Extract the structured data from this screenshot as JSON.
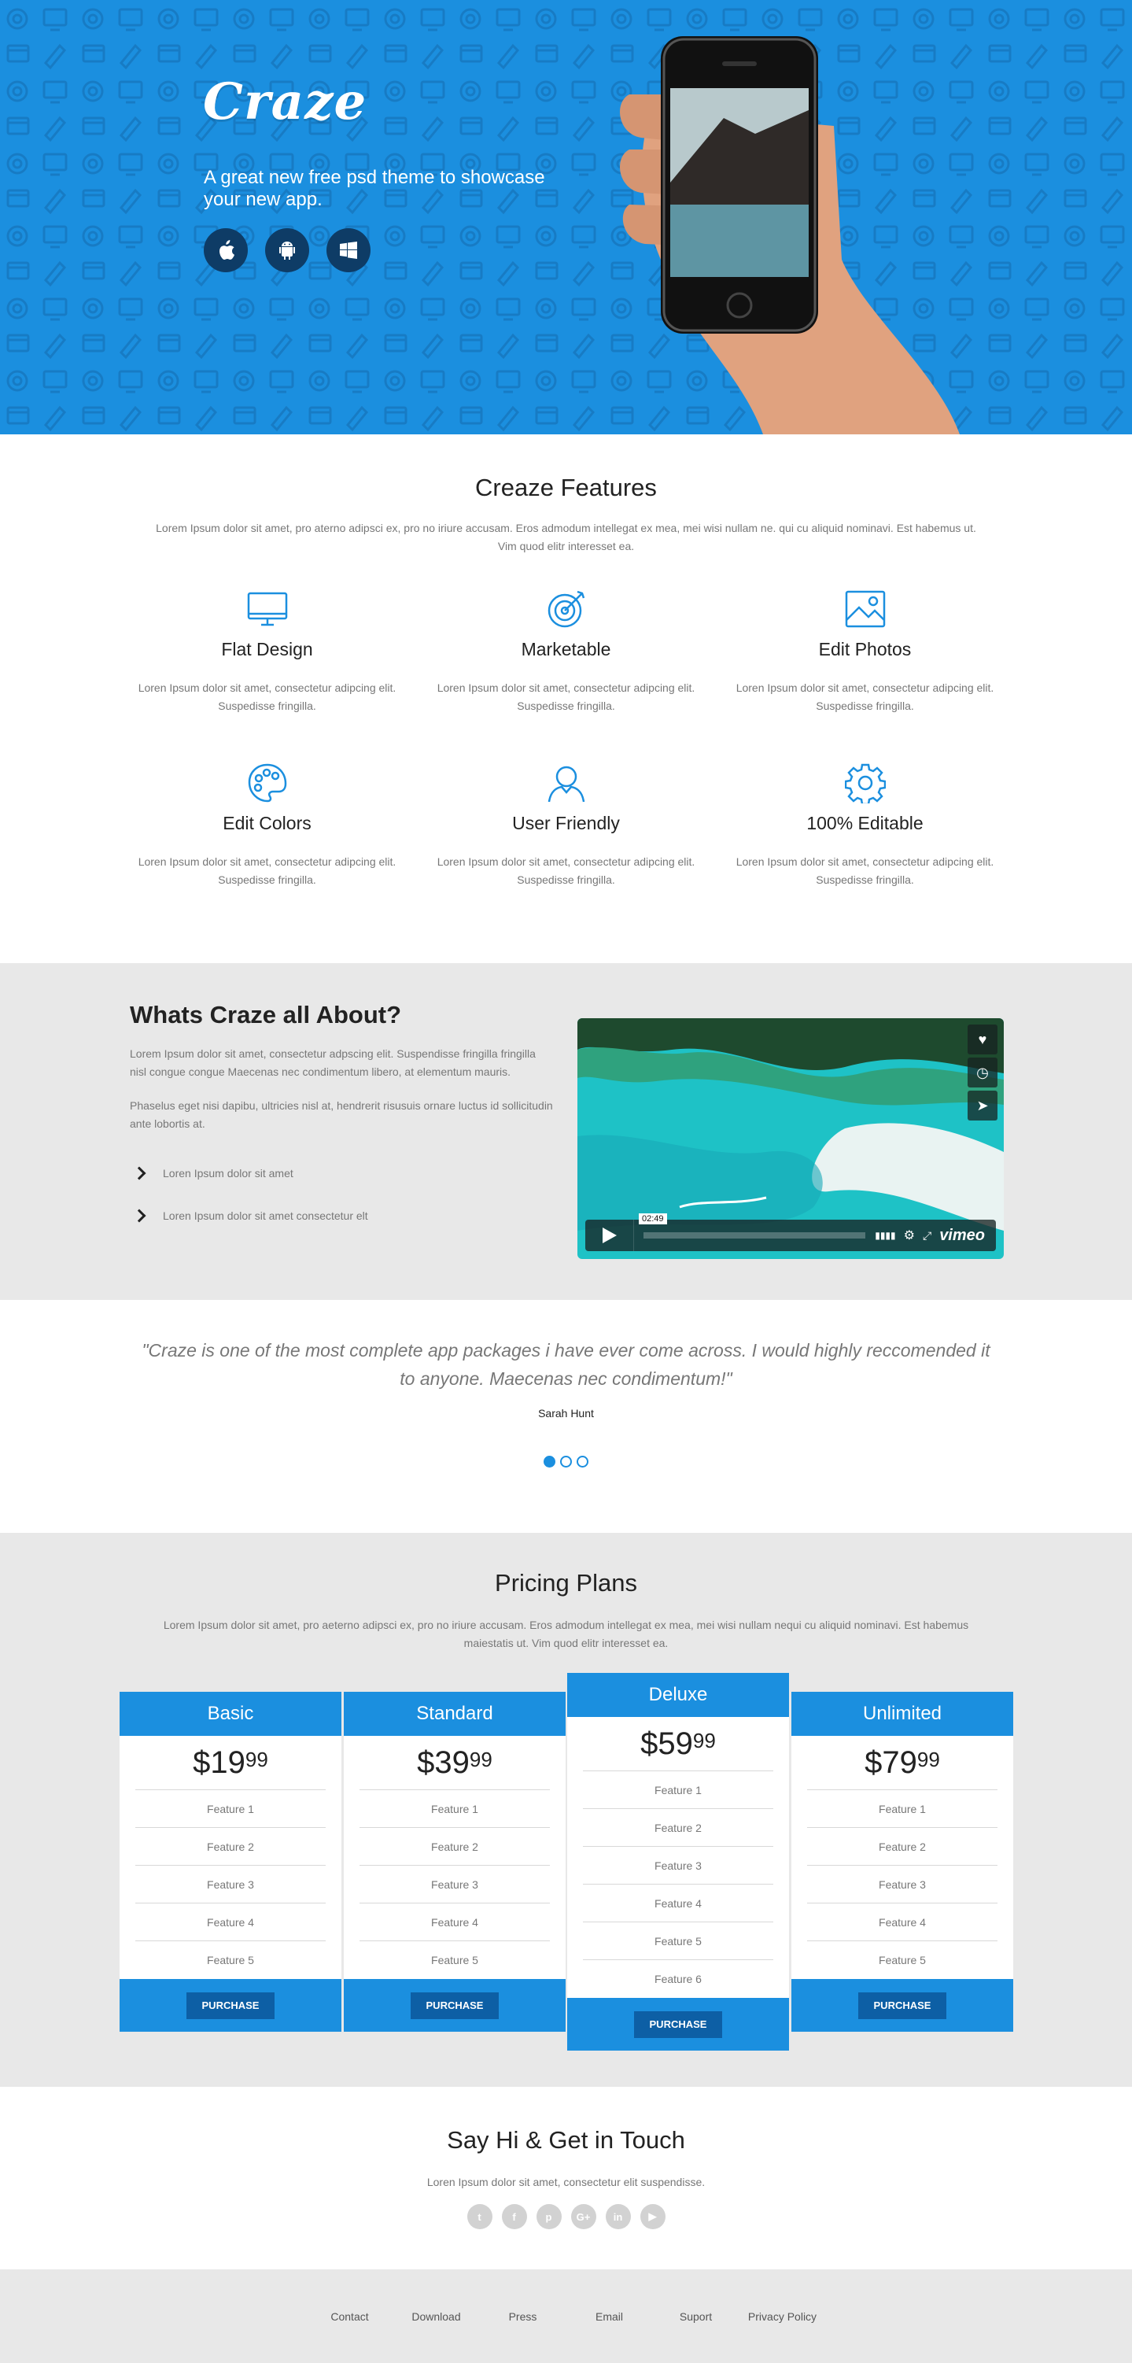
{
  "hero": {
    "logo": "Craze",
    "tagline": "A great new free psd theme to showcase your new app.",
    "store_buttons": [
      {
        "icon": "apple-icon"
      },
      {
        "icon": "android-icon"
      },
      {
        "icon": "windows-icon"
      }
    ]
  },
  "features": {
    "title": "Creaze Features",
    "subtitle": "Lorem Ipsum dolor sit amet, pro aterno adipsci ex, pro no iriure accusam. Eros admodum intellegat ex mea, mei wisi nullam ne. qui cu aliquid nominavi. Est habemus ut. Vim quod elitr interesset ea.",
    "items": [
      {
        "icon": "monitor-icon",
        "title": "Flat Design",
        "desc": "Loren Ipsum dolor sit amet, consectetur adipcing elit. Suspedisse fringilla."
      },
      {
        "icon": "target-icon",
        "title": "Marketable",
        "desc": "Loren Ipsum dolor sit amet, consectetur adipcing elit. Suspedisse fringilla."
      },
      {
        "icon": "image-icon",
        "title": "Edit Photos",
        "desc": "Loren Ipsum dolor sit amet, consectetur adipcing elit. Suspedisse fringilla."
      },
      {
        "icon": "palette-icon",
        "title": "Edit Colors",
        "desc": "Loren Ipsum dolor sit amet, consectetur adipcing elit. Suspedisse fringilla."
      },
      {
        "icon": "user-icon",
        "title": "User Friendly",
        "desc": "Loren Ipsum dolor sit amet, consectetur adipcing elit. Suspedisse fringilla."
      },
      {
        "icon": "gear-icon",
        "title": "100% Editable",
        "desc": "Loren Ipsum dolor sit amet, consectetur adipcing elit. Suspedisse fringilla."
      }
    ]
  },
  "about": {
    "title": "Whats Craze all About?",
    "p1": "Lorem Ipsum dolor sit amet, consectetur adpscing elit. Suspendisse fringilla fringilla nisl congue congue Maecenas nec condimentum libero, at elementum mauris.",
    "p2": "Phaselus eget nisi dapibu, ultricies nisl at, hendrerit risusuis ornare luctus id sollicitudin ante lobortis at.",
    "list": [
      "Loren Ipsum dolor sit amet",
      "Loren Ipsum dolor sit amet consectetur elt"
    ],
    "video": {
      "time": "02:49",
      "brand": "vimeo"
    }
  },
  "testimonial": {
    "quote": "\"Craze is one of the most complete app packages i have ever come across. I would highly reccomended it to anyone. Maecenas nec condimentum!\"",
    "author": "Sarah Hunt",
    "slides": 3,
    "active_slide": 1
  },
  "pricing": {
    "title": "Pricing Plans",
    "subtitle": "Lorem Ipsum dolor sit amet, pro aeterno adipsci ex, pro no iriure accusam. Eros admodum intellegat ex mea, mei wisi nullam nequi cu aliquid nominavi. Est habemus maiestatis ut. Vim quod elitr interesset ea.",
    "plans": [
      {
        "name": "Basic",
        "price_main": "$19",
        "price_cents": "99",
        "features": [
          "Feature 1",
          "Feature 2",
          "Feature 3",
          "Feature 4",
          "Feature 5"
        ],
        "button": "PURCHASE"
      },
      {
        "name": "Standard",
        "price_main": "$39",
        "price_cents": "99",
        "features": [
          "Feature 1",
          "Feature 2",
          "Feature 3",
          "Feature 4",
          "Feature 5"
        ],
        "button": "PURCHASE"
      },
      {
        "name": "Deluxe",
        "price_main": "$59",
        "price_cents": "99",
        "features": [
          "Feature 1",
          "Feature 2",
          "Feature 3",
          "Feature 4",
          "Feature 5",
          "Feature 6"
        ],
        "button": "PURCHASE"
      },
      {
        "name": "Unlimited",
        "price_main": "$79",
        "price_cents": "99",
        "features": [
          "Feature 1",
          "Feature 2",
          "Feature 3",
          "Feature 4",
          "Feature 5"
        ],
        "button": "PURCHASE"
      }
    ]
  },
  "contact": {
    "title": "Say Hi & Get in Touch",
    "subtitle": "Loren Ipsum dolor sit amet, consectetur elit suspendisse.",
    "social": [
      {
        "icon": "twitter-icon",
        "glyph": "t"
      },
      {
        "icon": "facebook-icon",
        "glyph": "f"
      },
      {
        "icon": "pinterest-icon",
        "glyph": "p"
      },
      {
        "icon": "google-plus-icon",
        "glyph": "G+"
      },
      {
        "icon": "linkedin-icon",
        "glyph": "in"
      },
      {
        "icon": "youtube-icon",
        "glyph": "▶"
      }
    ]
  },
  "footer": {
    "links": [
      "Contact",
      "Download",
      "Press",
      "Email",
      "Suport",
      "Privacy Policy"
    ]
  },
  "colors": {
    "brand_blue": "#1b8fdf",
    "dark_button": "#0d5fa5",
    "section_gray": "#e8e8e8"
  }
}
